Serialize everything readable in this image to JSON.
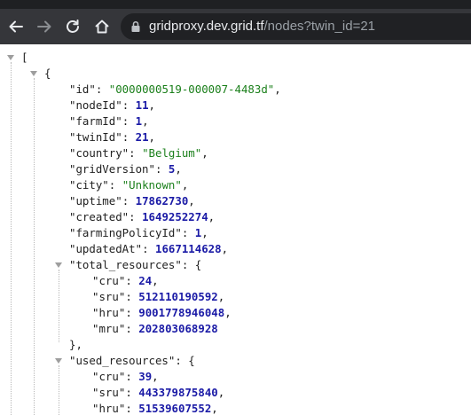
{
  "browser": {
    "url_host": "gridproxy.dev.grid.tf",
    "url_path": "/nodes?twin_id=21"
  },
  "json": {
    "open_bracket": "[",
    "open_brace": "{",
    "close_brace_nested": "},",
    "fields": {
      "id_key": "\"id\"",
      "id_value": "\"0000000519-000007-4483d\"",
      "nodeId_key": "\"nodeId\"",
      "nodeId_value": "11",
      "farmId_key": "\"farmId\"",
      "farmId_value": "1",
      "twinId_key": "\"twinId\"",
      "twinId_value": "21",
      "country_key": "\"country\"",
      "country_value": "\"Belgium\"",
      "gridVersion_key": "\"gridVersion\"",
      "gridVersion_value": "5",
      "city_key": "\"city\"",
      "city_value": "\"Unknown\"",
      "uptime_key": "\"uptime\"",
      "uptime_value": "17862730",
      "created_key": "\"created\"",
      "created_value": "1649252274",
      "farmingPolicyId_key": "\"farmingPolicyId\"",
      "farmingPolicyId_value": "1",
      "updatedAt_key": "\"updatedAt\"",
      "updatedAt_value": "1667114628",
      "total_resources_key": "\"total_resources\"",
      "used_resources_key": "\"used_resources\""
    },
    "total_resources": {
      "cru_key": "\"cru\"",
      "cru_value": "24",
      "sru_key": "\"sru\"",
      "sru_value": "512110190592",
      "hru_key": "\"hru\"",
      "hru_value": "9001778946048",
      "mru_key": "\"mru\"",
      "mru_value": "202803068928"
    },
    "used_resources": {
      "cru_key": "\"cru\"",
      "cru_value": "39",
      "sru_key": "\"sru\"",
      "sru_value": "443379875840",
      "hru_key": "\"hru\"",
      "hru_value": "51539607552"
    }
  }
}
